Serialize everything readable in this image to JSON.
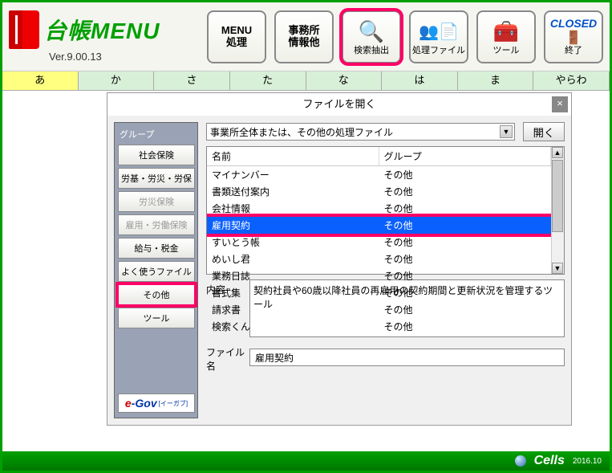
{
  "header": {
    "title": "台帳MENU",
    "version": "Ver.9.00.13",
    "buttons": [
      {
        "label": "MENU\n処理",
        "icon": ""
      },
      {
        "label": "事務所\n情報他",
        "icon": ""
      },
      {
        "label": "検索抽出",
        "icon": "🔍"
      },
      {
        "label": "処理ファイル",
        "icon": "👤📄"
      },
      {
        "label": "ツール",
        "icon": "🧰"
      },
      {
        "label": "終了",
        "icon": "CLOSED"
      }
    ]
  },
  "kana": [
    "あ",
    "か",
    "さ",
    "た",
    "な",
    "は",
    "ま",
    "やらわ"
  ],
  "dialog": {
    "title": "ファイルを開く",
    "group_label": "グループ",
    "groups": [
      "社会保険",
      "労基・労災・労保",
      "労災保険",
      "雇用・労働保険",
      "給与・税金",
      "よく使うファイル",
      "その他",
      "ツール"
    ],
    "dropdown": "事業所全体または、その他の処理ファイル",
    "open_btn": "開く",
    "list_headers": [
      "名前",
      "グループ"
    ],
    "rows": [
      {
        "name": "マイナンバー",
        "group": "その他"
      },
      {
        "name": "書類送付案内",
        "group": "その他"
      },
      {
        "name": "会社情報",
        "group": "その他"
      },
      {
        "name": "雇用契約",
        "group": "その他"
      },
      {
        "name": "すいとう帳",
        "group": "その他"
      },
      {
        "name": "めいし君",
        "group": "その他"
      },
      {
        "name": "業務日誌",
        "group": "その他"
      },
      {
        "name": "書式集",
        "group": "その他"
      },
      {
        "name": "請求書",
        "group": "その他"
      },
      {
        "name": "検索くん",
        "group": "その他"
      }
    ],
    "content_label": "内容",
    "content_value": "契約社員や60歳以降社員の再雇用の契約期間と更新状況を管理するツール",
    "filename_label": "ファイル名",
    "filename_value": "雇用契約",
    "egov_label": "e-Gov",
    "egov_sub": "[イーガブ]"
  },
  "footer": {
    "brand": "Cells",
    "date": "2016.10"
  }
}
